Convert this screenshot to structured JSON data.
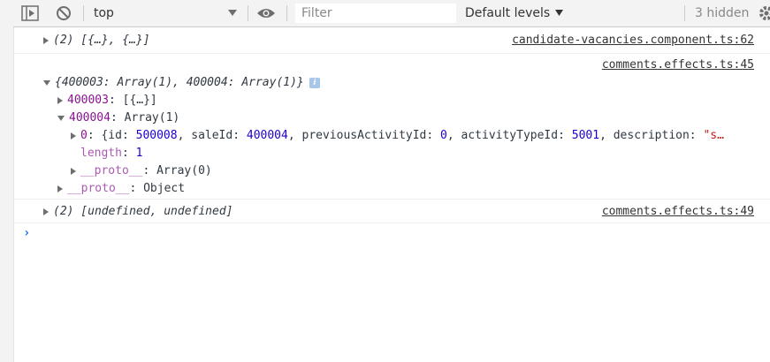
{
  "toolbar": {
    "context": "top",
    "filter_placeholder": "Filter",
    "levels_label": "Default levels",
    "hidden_count": "3 hidden"
  },
  "messages": [
    {
      "text": "(2) [{…}, {…}]",
      "source": "candidate-vacancies.component.ts:62"
    },
    {
      "source": "comments.effects.ts:45",
      "summary": "{400003: Array(1), 400004: Array(1)}",
      "badge": "i",
      "children": {
        "k1": "400003",
        "v1": "[{…}]",
        "k2": "400004",
        "v2": "Array(1)",
        "item_key": "0",
        "item_open": "{id: ",
        "id_val": "500008",
        "sale_label": ", saleId: ",
        "sale_val": "400004",
        "prev_label": ", previousActivityId: ",
        "prev_val": "0",
        "type_label": ", activityTypeId: ",
        "type_val": "5001",
        "desc_label": ", description: ",
        "desc_val": "\"s…",
        "length_key": "length",
        "length_val": "1",
        "proto_key": "__proto__",
        "proto_arr": "Array(0)",
        "proto_obj": "Object"
      }
    },
    {
      "text": "(2) [undefined, undefined]",
      "source": "comments.effects.ts:49"
    }
  ],
  "prompt_symbol": "›"
}
